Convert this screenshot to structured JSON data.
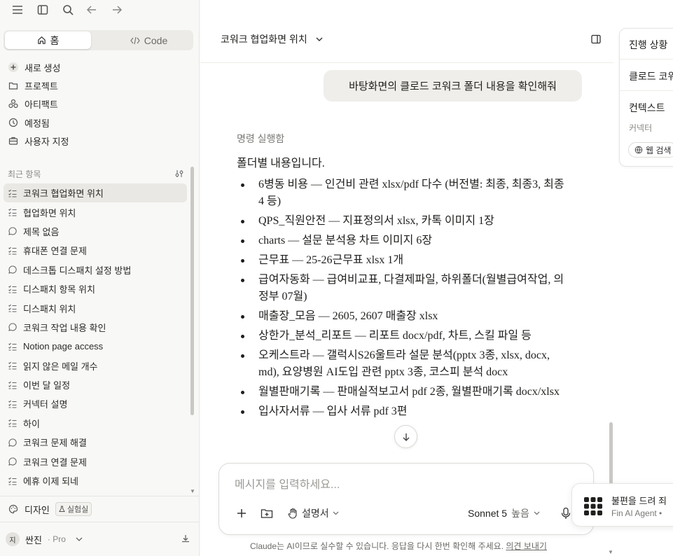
{
  "sidebar": {
    "mode_tabs": [
      {
        "label": "홈",
        "icon": "home-icon"
      },
      {
        "label": "Code",
        "icon": "code-icon"
      }
    ],
    "nav_items": [
      {
        "label": "새로 생성",
        "icon": "plus-icon"
      },
      {
        "label": "프로젝트",
        "icon": "folder-icon"
      },
      {
        "label": "아티팩트",
        "icon": "shapes-icon"
      },
      {
        "label": "예정됨",
        "icon": "clock-icon"
      },
      {
        "label": "사용자 지정",
        "icon": "briefcase-icon"
      }
    ],
    "recent_header": "최근 항목",
    "recent_items": [
      {
        "label": "코워크 협업화면 위치",
        "icon": "task-icon",
        "active": true
      },
      {
        "label": "협업화면 위치",
        "icon": "task-icon"
      },
      {
        "label": "제목 없음",
        "icon": "chat-icon"
      },
      {
        "label": "휴대폰 연결 문제",
        "icon": "task-icon"
      },
      {
        "label": "데스크톱 디스패치 설정 방법",
        "icon": "chat-icon"
      },
      {
        "label": "디스패치 항목 위치",
        "icon": "task-icon"
      },
      {
        "label": "디스패치 위치",
        "icon": "task-icon"
      },
      {
        "label": "코워크 작업 내용 확인",
        "icon": "chat-icon"
      },
      {
        "label": "Notion page access",
        "icon": "task-icon"
      },
      {
        "label": "읽지 않은 메일 개수",
        "icon": "task-icon"
      },
      {
        "label": "이번 달 일정",
        "icon": "task-icon"
      },
      {
        "label": "커넥터 설명",
        "icon": "task-icon"
      },
      {
        "label": "하이",
        "icon": "task-icon"
      },
      {
        "label": "코워크 문제 해결",
        "icon": "chat-icon"
      },
      {
        "label": "코워크 연결 문제",
        "icon": "chat-icon"
      },
      {
        "label": "에휴 이제 되네",
        "icon": "task-icon"
      }
    ],
    "design_label": "디자인",
    "design_badge": "실험실",
    "user": {
      "initial": "지",
      "name": "싼진",
      "plan": "· Pro"
    }
  },
  "header": {
    "chat_title": "코워크 협업화면 위치"
  },
  "conversation": {
    "user_message": "바탕화면의 클로드 코워크 폴더 내용을 확인해줘",
    "command_status": "명령 실행함",
    "intro": "폴더별 내용입니다.",
    "items": [
      "6병동 비용 — 인건비 관련 xlsx/pdf 다수 (버전별: 최종, 최종3, 최종4 등)",
      "QPS_직원안전 — 지표정의서 xlsx, 카톡 이미지 1장",
      "charts — 설문 분석용 차트 이미지 6장",
      "근무표 — 25-26근무표 xlsx 1개",
      "급여자동화 — 급여비교표, 다결제파일, 하위폴더(월별급여작업, 의정부 07월)",
      "매출장_모음 — 2605, 2607 매출장 xlsx",
      "상한가_분석_리포트 — 리포트 docx/pdf, 차트, 스킬 파일 등",
      "오케스트라 — 갤럭시S26울트라 설문 분석(pptx 3종, xlsx, docx, md), 요양병원 AI도입 관련 pptx 3종, 코스피 분석 docx",
      "월별판매기록 — 판매실적보고서 pdf 2종, 월별판매기록 docx/xlsx",
      "입사자서류 — 입사 서류 pdf 3편"
    ]
  },
  "composer": {
    "placeholder": "메시지를 입력하세요...",
    "style_label": "설명서",
    "model": "Sonnet 5",
    "effort": "높음"
  },
  "disclaimer": {
    "text": "Claude는 AI이므로 실수할 수 있습니다. 응답을 다시 한번 확인해 주세요. ",
    "link": "의견 보내기"
  },
  "right_panel": {
    "progress": "진행 상황",
    "claude_cowork": "클로드 코워",
    "context": "컨텍스트",
    "connectors": "커넥터",
    "web_search": "웹 검색"
  },
  "fin_toast": {
    "message": "불편을 드려 죄",
    "from": "Fin AI Agent •"
  }
}
